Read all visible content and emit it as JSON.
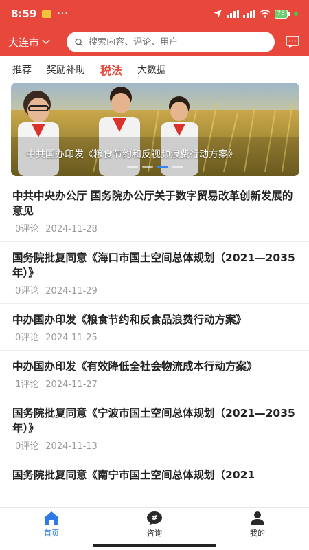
{
  "status_bar": {
    "time": "8:59",
    "dots": "···",
    "battery": "73"
  },
  "header": {
    "city": "大连市",
    "search_placeholder": "搜索内容、评论、用户"
  },
  "tabs": [
    {
      "label": "推荐",
      "active": false
    },
    {
      "label": "奖励补助",
      "active": false
    },
    {
      "label": "税法",
      "active": true
    },
    {
      "label": "大数据",
      "active": false
    }
  ],
  "banner": {
    "caption": "中共国办印发《粮食节约和反视频浪费行动方案》"
  },
  "news": [
    {
      "title": "中共中央办公厅 国务院办公厅关于数字贸易改革创新发展的意见",
      "comments": "0评论",
      "date": "2024-11-28"
    },
    {
      "title": "国务院批复同意《海口市国土空间总体规划（2021—2035年）》",
      "comments": "0评论",
      "date": "2024-11-29"
    },
    {
      "title": "中办国办印发《粮食节约和反食品浪费行动方案》",
      "comments": "0评论",
      "date": "2024-11-25"
    },
    {
      "title": "中办国办印发《有效降低全社会物流成本行动方案》",
      "comments": "1评论",
      "date": "2024-11-27"
    },
    {
      "title": "国务院批复同意《宁波市国土空间总体规划（2021—2035年）》",
      "comments": "0评论",
      "date": "2024-11-13"
    },
    {
      "title": "国务院批复同意《南宁市国土空间总体规划（2021",
      "comments": "",
      "date": ""
    }
  ],
  "bottom_nav": {
    "home": "首页",
    "consult": "咨询",
    "mine": "我的"
  },
  "colors": {
    "brand_red": "#e8483c",
    "active_blue": "#2f7ae5"
  }
}
